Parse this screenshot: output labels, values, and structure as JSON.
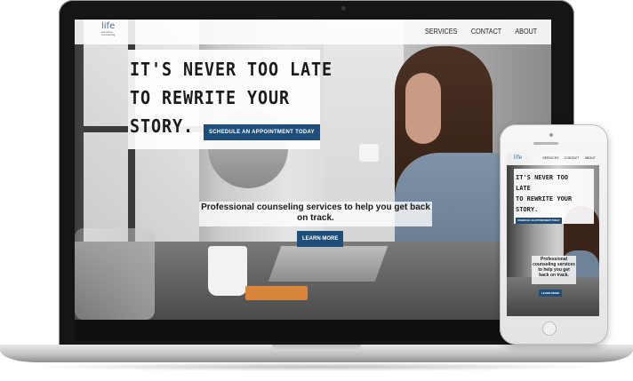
{
  "site": {
    "logo": {
      "main": "life",
      "sub": "solutions counseling"
    },
    "nav": [
      {
        "label": "SERVICES"
      },
      {
        "label": "CONTACT"
      },
      {
        "label": "ABOUT"
      }
    ],
    "hero": {
      "title_lines": [
        "IT'S NEVER TOO LATE",
        "TO REWRITE YOUR",
        "STORY."
      ],
      "cta_label": "SCHEDULE AN APPOINTMENT TODAY",
      "tagline": "Professional counseling services to help you get back on track.",
      "learn_more_label": "LEARN MORE"
    }
  },
  "mobile": {
    "title_lines": [
      "IT'S NEVER TOO",
      "LATE",
      "TO REWRITE YOUR",
      "STORY."
    ]
  },
  "colors": {
    "accent": "#1f4e79",
    "logo": "#4a6d8a"
  }
}
